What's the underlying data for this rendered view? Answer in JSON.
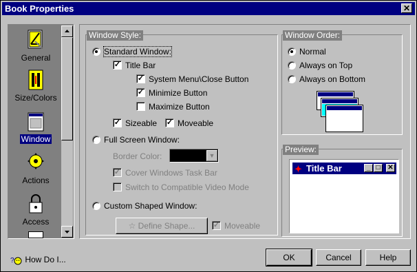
{
  "window": {
    "title": "Book Properties",
    "close_glyph": "✕"
  },
  "sidebar": {
    "items": [
      {
        "label": "General",
        "icon": "general-icon",
        "selected": false
      },
      {
        "label": "Size/Colors",
        "icon": "size-colors-icon",
        "selected": false
      },
      {
        "label": "Window",
        "icon": "window-icon",
        "selected": true
      },
      {
        "label": "Actions",
        "icon": "actions-icon",
        "selected": false
      },
      {
        "label": "Access",
        "icon": "lock-icon",
        "selected": false
      }
    ]
  },
  "window_style": {
    "title": "Window Style:",
    "standard": {
      "label": "Standard Window:",
      "selected": true
    },
    "title_bar": {
      "label": "Title Bar",
      "checked": true
    },
    "system_menu": {
      "label": "System Menu\\Close Button",
      "checked": true
    },
    "minimize": {
      "label": "Minimize Button",
      "checked": true
    },
    "maximize": {
      "label": "Maximize Button",
      "checked": false
    },
    "sizeable": {
      "label": "Sizeable",
      "checked": true
    },
    "moveable": {
      "label": "Moveable",
      "checked": true
    },
    "fullscreen": {
      "label": "Full Screen Window:",
      "selected": false
    },
    "border_color": {
      "label": "Border Color:",
      "value_color": "#000000"
    },
    "cover_taskbar": {
      "label": "Cover Windows Task Bar",
      "checked": true,
      "disabled": true
    },
    "compat_video": {
      "label": "Switch to Compatible Video Mode",
      "checked": false,
      "disabled": true
    },
    "custom": {
      "label": "Custom Shaped Window:",
      "selected": false
    },
    "define_shape": {
      "label": "Define Shape...",
      "disabled": true
    },
    "custom_moveable": {
      "label": "Moveable",
      "checked": true,
      "disabled": true
    }
  },
  "window_order": {
    "title": "Window Order:",
    "options": [
      {
        "label": "Normal",
        "selected": true
      },
      {
        "label": "Always on Top",
        "selected": false
      },
      {
        "label": "Always on Bottom",
        "selected": false
      }
    ]
  },
  "preview": {
    "title": "Preview:",
    "window_title": "Title Bar"
  },
  "footer": {
    "how_do_i": "How Do I...",
    "ok": "OK",
    "cancel": "Cancel",
    "help": "Help"
  },
  "colors": {
    "title_bar": "#000080",
    "face": "#c0c0c0",
    "selection": "#000080"
  }
}
